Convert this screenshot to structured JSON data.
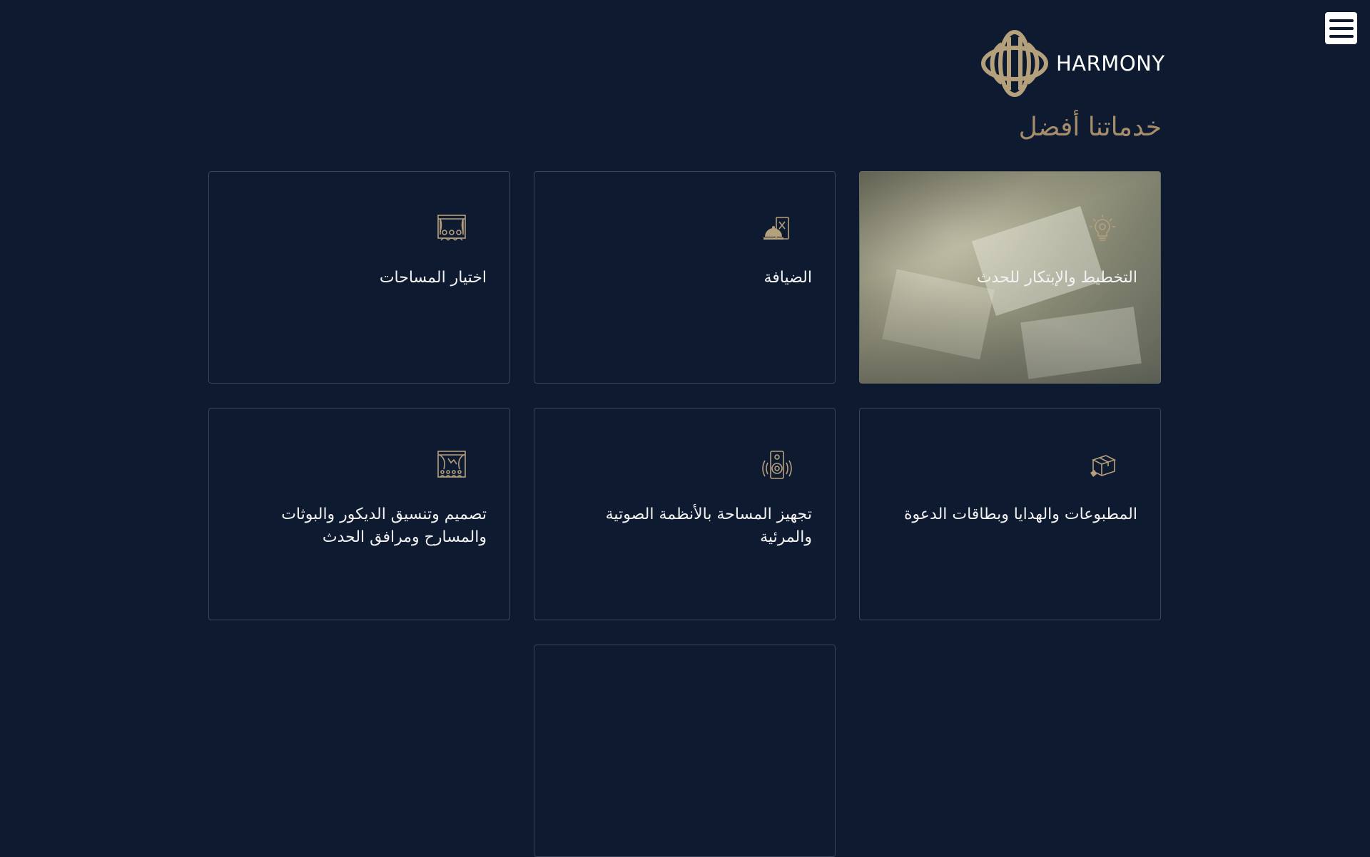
{
  "brand": {
    "name": "HARMONY"
  },
  "menu": {
    "icon": "hamburger-menu-icon"
  },
  "section": {
    "title": "خدماتنا أفضل"
  },
  "services": [
    {
      "title": "التخطيط والإبتكار للحدث",
      "icon": "lightbulb-gear-icon",
      "featured": true
    },
    {
      "title": "الضيافة",
      "icon": "hospitality-cloche-icon",
      "featured": false
    },
    {
      "title": "اختيار المساحات",
      "icon": "venue-stage-icon",
      "featured": false
    },
    {
      "title": "المطبوعات والهدايا وبطاقات الدعوة",
      "icon": "gift-box-icon",
      "featured": false
    },
    {
      "title": "تجهيز المساحة بالأنظمة الصوتية والمرئية",
      "icon": "speaker-icon",
      "featured": false
    },
    {
      "title": "تصميم وتنسيق الديكور والبوثات والمسارح ومرافق الحدث",
      "icon": "theater-curtain-icon",
      "featured": false
    }
  ],
  "colors": {
    "background": "#0e1a30",
    "accent": "#a58d6c",
    "border": "#3a4558"
  }
}
